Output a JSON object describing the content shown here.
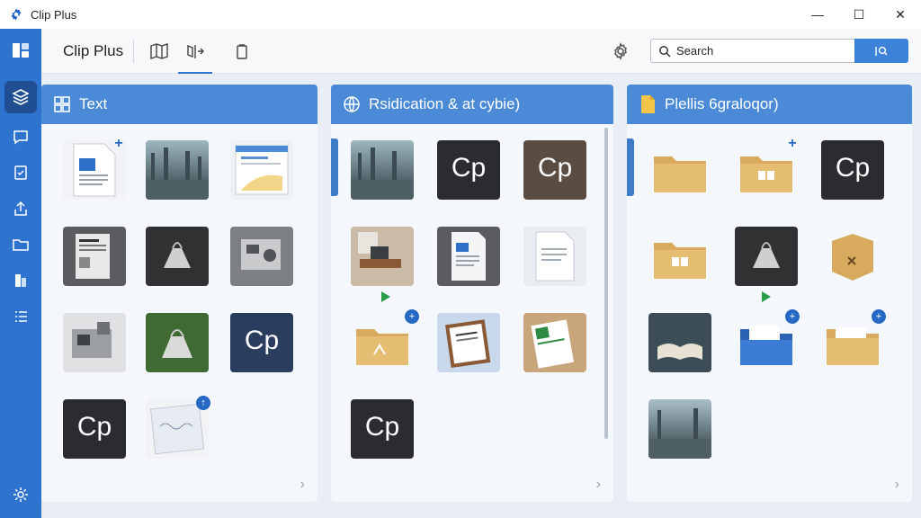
{
  "window": {
    "title": "Clip Plus",
    "controls": {
      "minimize": "—",
      "maximize": "☐",
      "close": "✕"
    }
  },
  "rail": {
    "items": [
      {
        "icon": "dashboard-icon"
      },
      {
        "icon": "layers-icon",
        "active": true
      },
      {
        "icon": "comment-icon"
      },
      {
        "icon": "checklist-icon"
      },
      {
        "icon": "upload-icon"
      },
      {
        "icon": "folder-icon"
      },
      {
        "icon": "columns-icon"
      },
      {
        "icon": "list-icon"
      },
      {
        "icon": "settings-icon"
      }
    ]
  },
  "toolbar": {
    "app_name": "Clip Plus",
    "tools": [
      "map-icon",
      "split-icon",
      "clipboard-icon"
    ],
    "search_placeholder": "Search"
  },
  "panels": [
    {
      "title": "Text",
      "icon": "grid-icon"
    },
    {
      "title": "Rsidication & at cybie)",
      "icon": "globe-icon"
    },
    {
      "title": "Plellis 6graloqor)",
      "icon": "document-icon"
    }
  ],
  "tiles": {
    "cp_label": "Cp"
  },
  "colors": {
    "accent": "#2e73cd",
    "header": "#4a8ad6",
    "badge": "#2569c4",
    "play": "#2a9d4a"
  }
}
